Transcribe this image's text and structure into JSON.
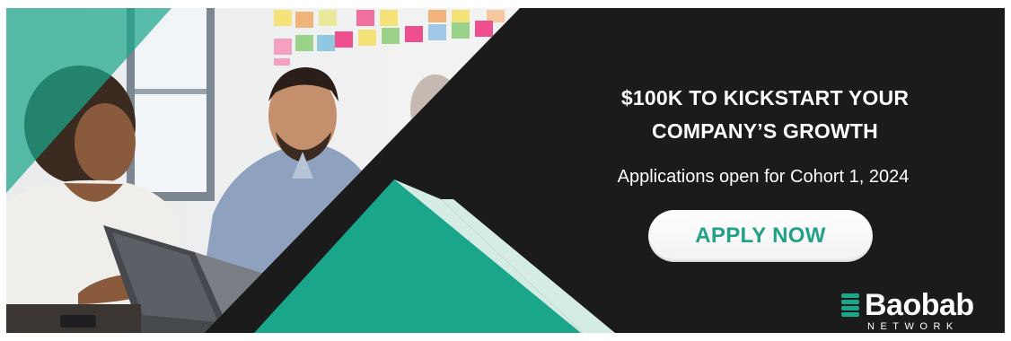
{
  "banner": {
    "headline": {
      "line1": "$100K TO KICKSTART YOUR",
      "line2": "COMPANY’S GROWTH"
    },
    "subheadline": "Applications open for Cohort 1, 2024",
    "cta_label": "APPLY NOW",
    "logo": {
      "name": "Baobab",
      "tagline": "NETWORK"
    }
  },
  "colors": {
    "background_dark": "#1b1b1b",
    "brand_green": "#1aa68a",
    "light_green": "#d5ece4",
    "cta_text": "#22a187",
    "text_white": "#ffffff"
  }
}
